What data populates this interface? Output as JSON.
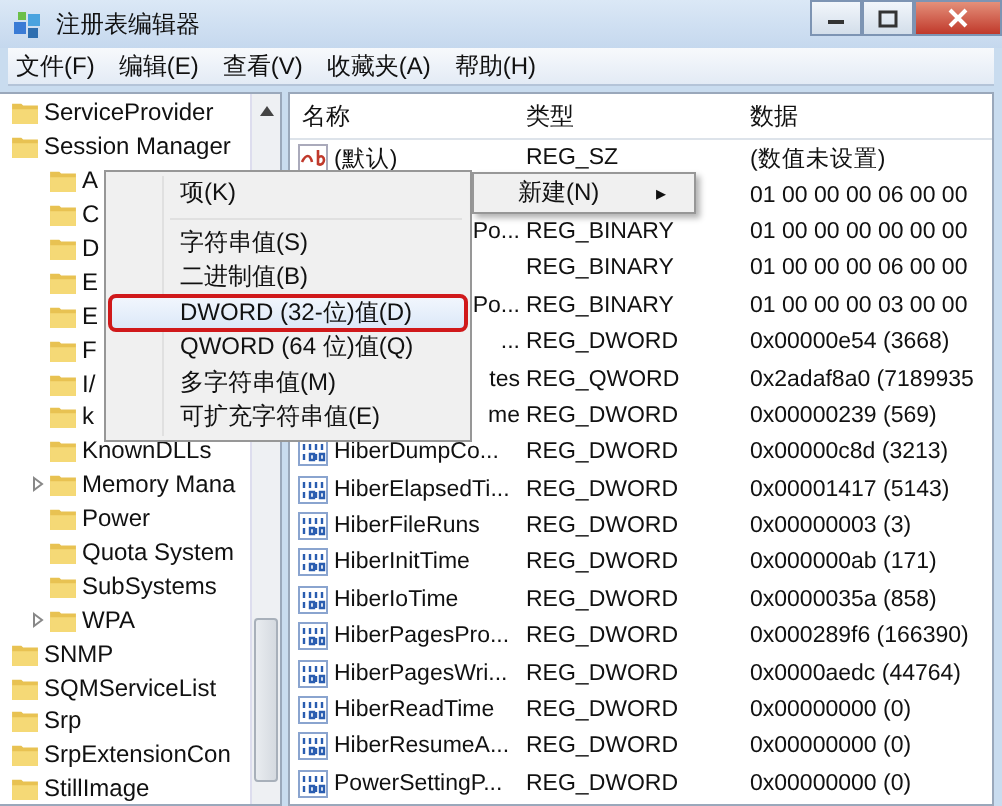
{
  "window": {
    "title": "注册表编辑器"
  },
  "menu_bar": [
    "文件(F)",
    "编辑(E)",
    "查看(V)",
    "收藏夹(A)",
    "帮助(H)"
  ],
  "tree": [
    {
      "label": "ServiceProvider"
    },
    {
      "label": "Session Manager",
      "children": [
        {
          "label": "A",
          "has_children": false
        },
        {
          "label": "C",
          "has_children": false
        },
        {
          "label": "D",
          "has_children": false
        },
        {
          "label": "E",
          "has_children": false
        },
        {
          "label": "E",
          "has_children": false
        },
        {
          "label": "F",
          "has_children": false
        },
        {
          "label": "I/",
          "has_children": false
        },
        {
          "label": "k",
          "has_children": false
        },
        {
          "label": "KnownDLLs",
          "has_children": false
        },
        {
          "label": "Memory Mana",
          "has_children": true
        },
        {
          "label": "Power",
          "has_children": false
        },
        {
          "label": "Quota System",
          "has_children": false
        },
        {
          "label": "SubSystems",
          "has_children": false
        },
        {
          "label": "WPA",
          "has_children": true
        }
      ]
    },
    {
      "label": "SNMP"
    },
    {
      "label": "SQMServiceList"
    },
    {
      "label": "Srp"
    },
    {
      "label": "SrpExtensionCon"
    },
    {
      "label": "StillImage"
    }
  ],
  "values": {
    "columns": [
      "名称",
      "类型",
      "数据"
    ],
    "rows": [
      {
        "kind": "string",
        "name": "(默认)",
        "type": "REG_SZ",
        "data": "(数值未设置)"
      },
      {
        "name": "",
        "type": "",
        "data": "01 00 00 00 06 00 00"
      },
      {
        "name": "Po...",
        "type": "REG_BINARY",
        "data": "01 00 00 00 00 00 00"
      },
      {
        "name": "",
        "type": "REG_BINARY",
        "data": "01 00 00 00 06 00 00"
      },
      {
        "name": "Po...",
        "type": "REG_BINARY",
        "data": "01 00 00 00 03 00 00"
      },
      {
        "name": "...",
        "type": "REG_DWORD",
        "data": "0x00000e54 (3668)"
      },
      {
        "name": "tes",
        "type": "REG_QWORD",
        "data": "0x2adaf8a0 (7189935"
      },
      {
        "name": "me",
        "type": "REG_DWORD",
        "data": "0x00000239 (569)"
      },
      {
        "kind": "binary",
        "name": "HiberDumpCo...",
        "type": "REG_DWORD",
        "data": "0x00000c8d (3213)"
      },
      {
        "kind": "binary",
        "name": "HiberElapsedTi...",
        "type": "REG_DWORD",
        "data": "0x00001417 (5143)"
      },
      {
        "kind": "binary",
        "name": "HiberFileRuns",
        "type": "REG_DWORD",
        "data": "0x00000003 (3)"
      },
      {
        "kind": "binary",
        "name": "HiberInitTime",
        "type": "REG_DWORD",
        "data": "0x000000ab (171)"
      },
      {
        "kind": "binary",
        "name": "HiberIoTime",
        "type": "REG_DWORD",
        "data": "0x0000035a (858)"
      },
      {
        "kind": "binary",
        "name": "HiberPagesPro...",
        "type": "REG_DWORD",
        "data": "0x000289f6 (166390)"
      },
      {
        "kind": "binary",
        "name": "HiberPagesWri...",
        "type": "REG_DWORD",
        "data": "0x0000aedc (44764)"
      },
      {
        "kind": "binary",
        "name": "HiberReadTime",
        "type": "REG_DWORD",
        "data": "0x00000000 (0)"
      },
      {
        "kind": "binary",
        "name": "HiberResumeA...",
        "type": "REG_DWORD",
        "data": "0x00000000 (0)"
      },
      {
        "kind": "binary",
        "name": "PowerSettingP...",
        "type": "REG_DWORD",
        "data": "0x00000000 (0)"
      }
    ]
  },
  "context_menu": {
    "items": [
      {
        "label": "项(K)",
        "selected": false,
        "highlighted": false
      },
      {
        "label": "字符串值(S)",
        "selected": false,
        "highlighted": false
      },
      {
        "label": "二进制值(B)",
        "selected": false,
        "highlighted": false
      },
      {
        "label": "DWORD (32-位)值(D)",
        "selected": true,
        "highlighted": true
      },
      {
        "label": "QWORD (64 位)值(Q)",
        "selected": false,
        "highlighted": false
      },
      {
        "label": "多字符串值(M)",
        "selected": false,
        "highlighted": false
      },
      {
        "label": "可扩充字符串值(E)",
        "selected": false,
        "highlighted": false
      }
    ],
    "parent_item": {
      "label": "新建(N)",
      "arrow": "▸"
    }
  }
}
